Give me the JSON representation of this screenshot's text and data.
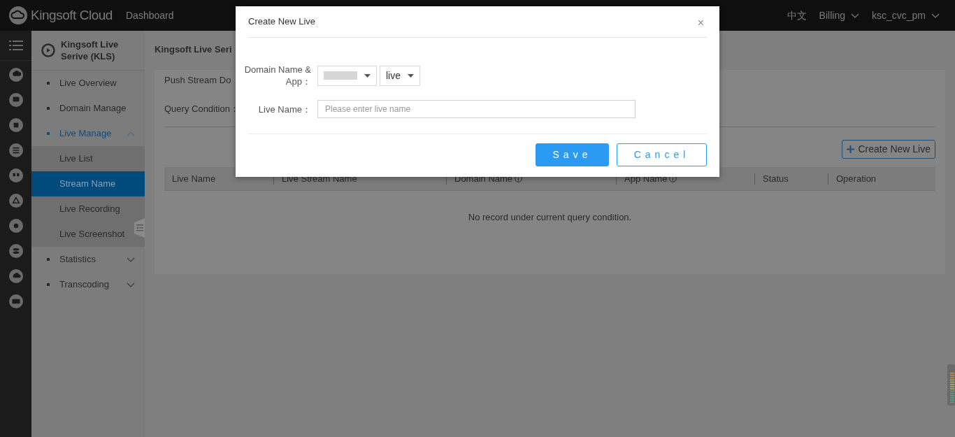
{
  "header": {
    "logo_text": "Kingsoft Cloud",
    "nav": "Dashboard",
    "right": [
      {
        "label": "中文",
        "dropdown": false
      },
      {
        "label": "Billing",
        "dropdown": true
      },
      {
        "label": "ksc_cvc_pm",
        "dropdown": true
      }
    ]
  },
  "sidebar": {
    "title": "Kingsoft Live Serive (KLS)",
    "items": [
      {
        "label": "Live Overview",
        "selected": false
      },
      {
        "label": "Domain Manage",
        "selected": false
      },
      {
        "label": "Live Manage",
        "selected": true,
        "expanded": true,
        "children": [
          {
            "label": "Live List",
            "selected": false
          },
          {
            "label": "Stream Name",
            "selected": true
          },
          {
            "label": "Live Recording",
            "selected": false
          },
          {
            "label": "Live Screenshot",
            "selected": false
          }
        ]
      },
      {
        "label": "Statistics",
        "selected": false,
        "expanded": false
      },
      {
        "label": "Transcoding",
        "selected": false,
        "expanded": false
      }
    ]
  },
  "page": {
    "title": "Kingsoft Live Seri",
    "filters": [
      "Push Stream Do",
      "Query Condition："
    ],
    "create_button": "Create New Live",
    "table": {
      "columns": [
        {
          "label": "Live Name",
          "info": false
        },
        {
          "label": "Live Stream Name",
          "info": false
        },
        {
          "label": "Domain Name",
          "info": true
        },
        {
          "label": "App Name",
          "info": true
        },
        {
          "label": "Status",
          "info": false
        },
        {
          "label": "Operation",
          "info": false
        }
      ],
      "empty_text": "No record under current query condition."
    }
  },
  "modal": {
    "title": "Create New Live",
    "close": "×",
    "fields": [
      {
        "kind": "selects",
        "label": "Domain Name & App：",
        "selects": [
          {
            "redacted": true
          },
          {
            "redacted": false,
            "value": "live"
          }
        ]
      },
      {
        "kind": "text",
        "label": "Live Name：",
        "placeholder": "Please enter live name"
      }
    ],
    "buttons": [
      {
        "label": "Save",
        "kind": "primary"
      },
      {
        "label": "Cancel",
        "kind": "secondary"
      }
    ]
  }
}
